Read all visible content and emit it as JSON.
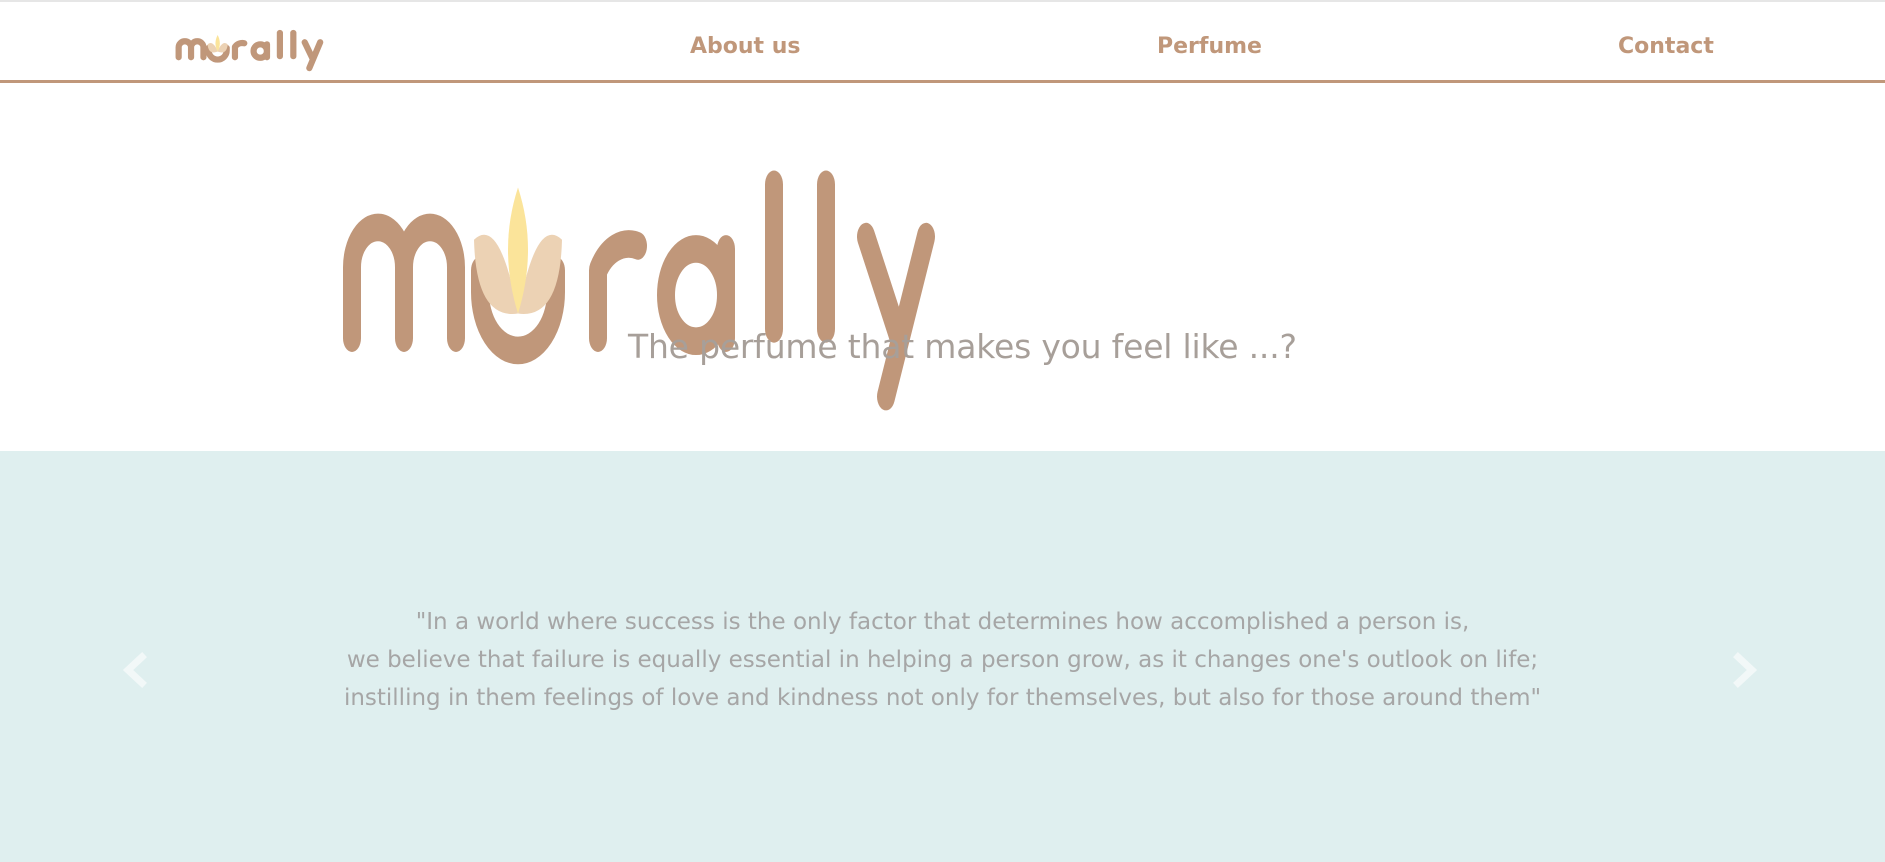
{
  "brand": {
    "name": "murally",
    "logo_color": "#c0977a",
    "petal_light": "#ecd2b4",
    "petal_center": "#fbe49a"
  },
  "nav": {
    "items": [
      {
        "label": "About us"
      },
      {
        "label": "Perfume"
      },
      {
        "label": "Contact"
      }
    ],
    "link_color": "#c0977a",
    "border_color": "#c0977a"
  },
  "hero": {
    "tagline": "The perfume that makes you feel like ...?"
  },
  "carousel": {
    "background": "#dfefef",
    "quote_lines": [
      "\"In a world where success is the only factor that determines how accomplished a person is,",
      "we believe that failure is equally essential in helping a person grow, as it changes one's outlook on life;",
      "instilling in them feelings of love and kindness not only for themselves, but also for those around them\""
    ],
    "prev_icon": "chevron-left-icon",
    "next_icon": "chevron-right-icon"
  }
}
